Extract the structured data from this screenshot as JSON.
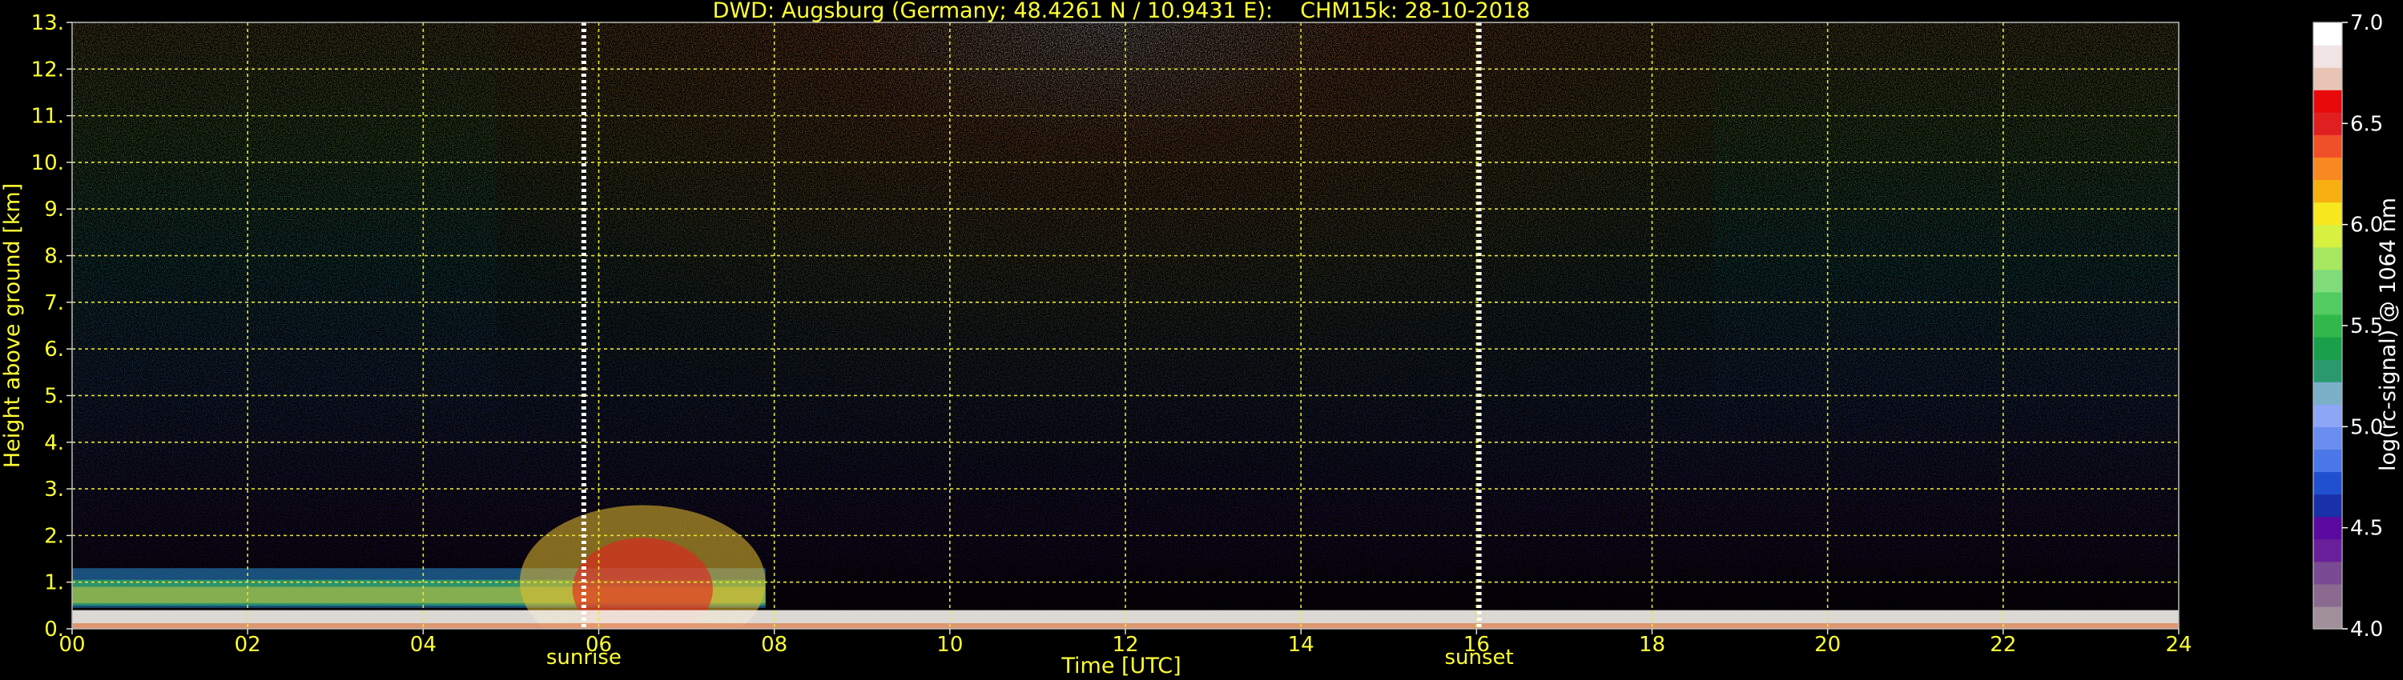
{
  "chart_data": {
    "type": "heatmap",
    "title": "DWD: Augsburg (Germany; 48.4261 N / 10.9431 E):    CHM15k: 28-10-2018",
    "xlabel": "Time [UTC]",
    "ylabel": "Height above ground [km]",
    "xlim": [
      0,
      24
    ],
    "ylim": [
      0.0,
      13.0
    ],
    "x_ticks": [
      "00",
      "02",
      "04",
      "06",
      "08",
      "10",
      "12",
      "14",
      "16",
      "18",
      "20",
      "22",
      "24"
    ],
    "y_ticks": [
      "0.",
      "1.",
      "2.",
      "3.",
      "4.",
      "5.",
      "6.",
      "7.",
      "8.",
      "9.",
      "10.",
      "11.",
      "12.",
      "13."
    ],
    "grid": true,
    "annotations": [
      {
        "label": "sunrise",
        "x": 5.83
      },
      {
        "label": "sunset",
        "x": 16.03
      }
    ],
    "colorbar": {
      "label": "log(rc-signal) @ 1064 nm",
      "range": [
        4.0,
        7.0
      ],
      "ticks": [
        "4.0",
        "4.5",
        "5.0",
        "5.5",
        "6.0",
        "6.5",
        "7.0"
      ],
      "colors": [
        "#a0909a",
        "#8a6a8e",
        "#7a4a92",
        "#6a1f9a",
        "#5a0a9e",
        "#1a30a8",
        "#2050d0",
        "#4a78e8",
        "#6a8ef0",
        "#8ea6f6",
        "#7ab0c8",
        "#2a9a6e",
        "#1aa04a",
        "#30b84a",
        "#50cc60",
        "#80dc78",
        "#a8e860",
        "#d8f040",
        "#f8e820",
        "#f8b010",
        "#f88820",
        "#f05028",
        "#e02020",
        "#e80a0a",
        "#e8c4b4",
        "#f0e4e4",
        "#ffffff"
      ]
    },
    "features": [
      {
        "name": "boundary layer",
        "x": [
          0,
          24
        ],
        "height_km": [
          0.0,
          0.4
        ]
      },
      {
        "name": "aerosol layer",
        "x": [
          0.0,
          7.9
        ],
        "height_km": [
          0.4,
          1.8
        ],
        "peak_time": 6.5
      }
    ]
  }
}
